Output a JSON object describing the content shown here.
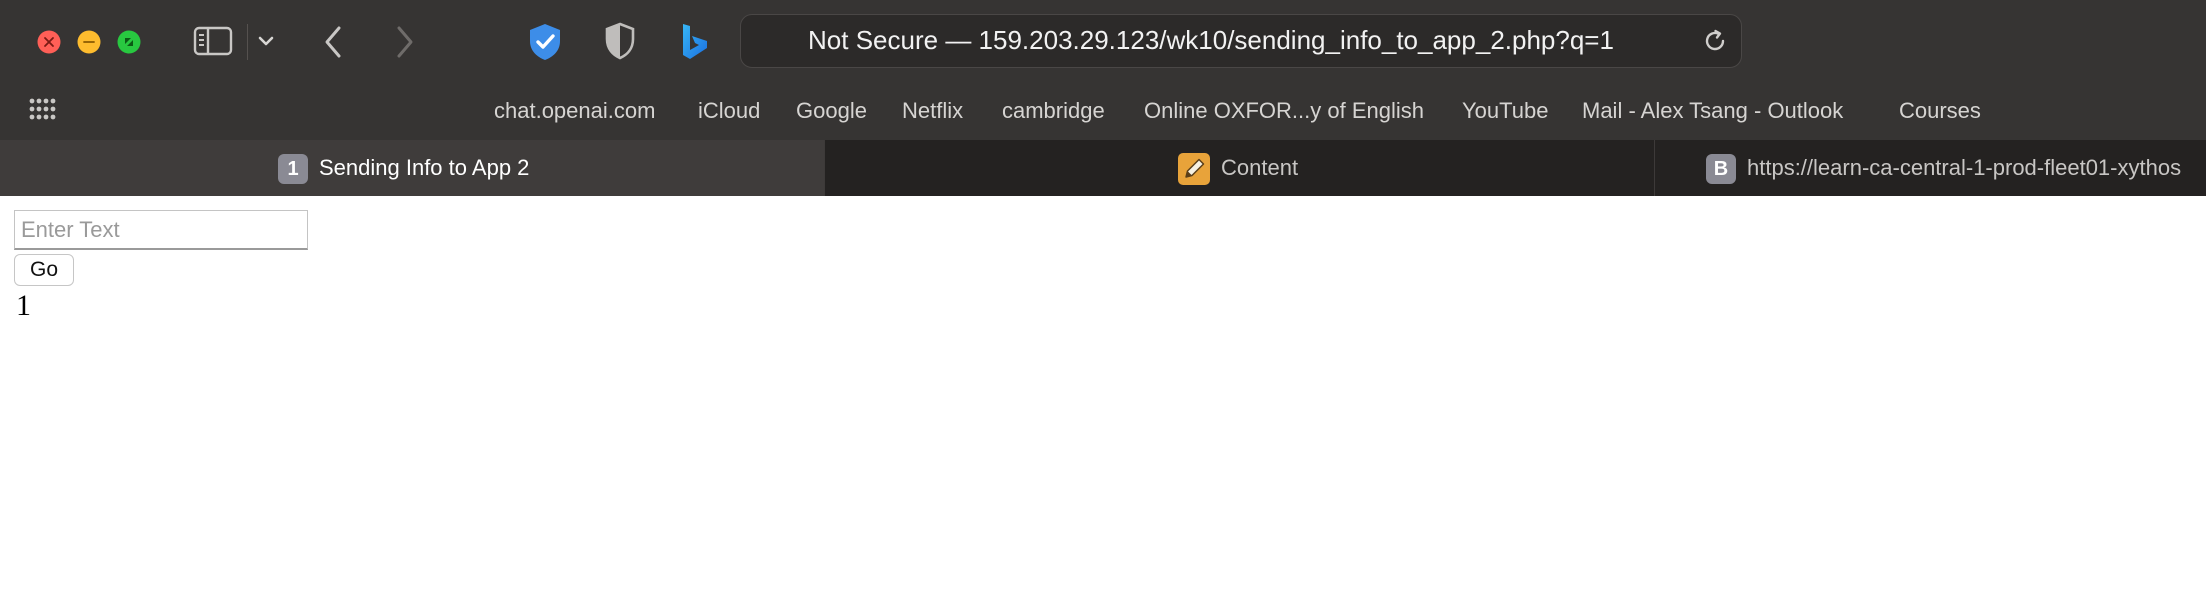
{
  "colors": {
    "close": "#ff5f57",
    "minimize": "#febc2e",
    "zoom": "#28c840",
    "chrome_bg": "#363433",
    "shield_blue": "#3d8de8"
  },
  "toolbar": {
    "traffic_lights": [
      "close-icon",
      "minimize-icon",
      "zoom-icon"
    ],
    "icons": [
      "sidebar-icon",
      "chevron-down-icon",
      "back-icon",
      "forward-icon",
      "shield-check-icon",
      "shield-half-icon",
      "bing-icon"
    ]
  },
  "urlbar": {
    "text": "Not Secure — 159.203.29.123/wk10/sending_info_to_app_2.php?q=1",
    "reload_icon": "reload-icon"
  },
  "bookmarks": {
    "grid_icon": "grid-icon",
    "items": [
      "chat.openai.com",
      "iCloud",
      "Google",
      "Netflix",
      "cambridge",
      "Online OXFOR...y of English",
      "YouTube",
      "Mail - Alex Tsang - Outlook",
      "Courses"
    ]
  },
  "tabs": [
    {
      "badge": "1",
      "label": "Sending Info to App 2",
      "active": true
    },
    {
      "icon": "pencil-icon",
      "label": "Content",
      "active": false
    },
    {
      "badge": "B",
      "label": "https://learn-ca-central-1-prod-fleet01-xythos",
      "active": false
    }
  ],
  "page": {
    "input_placeholder": "Enter Text",
    "input_value": "",
    "button_label": "Go",
    "output_text": "1"
  }
}
